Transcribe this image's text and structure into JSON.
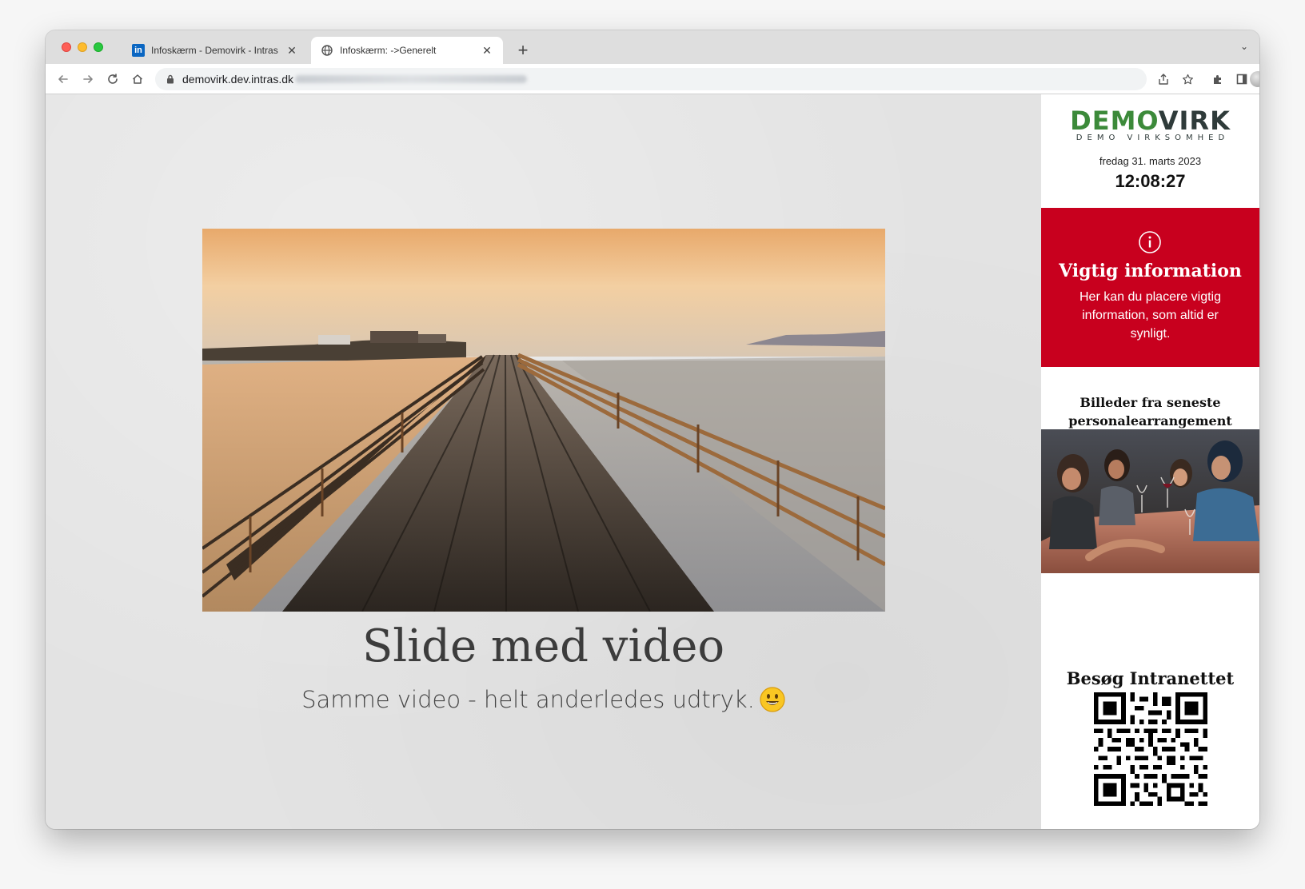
{
  "browser": {
    "tabs": [
      {
        "label": "Infoskærm - Demovirk - Intras",
        "favicon": "linkedin-icon",
        "favicon_text": "in",
        "active": false
      },
      {
        "label": "Infoskærm: ->Generelt",
        "favicon": "globe-icon",
        "active": true
      }
    ],
    "url": "demovirk.dev.intras.dk",
    "colors": {
      "active_tab": "#ffffff",
      "tab_strip": "#dedede"
    }
  },
  "slide": {
    "title": "Slide med video",
    "subtitle": "Samme video - helt anderledes udtryk.",
    "subtitle_emoji": "smiley-icon",
    "image": "boardwalk-pier-sunset-photo"
  },
  "sidebar": {
    "logo": {
      "part1": "DEMO",
      "part2": "VIRK",
      "tagline": "DEMO VIRKSOMHED",
      "colors": {
        "demo": "#3c8a3a",
        "virk": "#2f3b3a"
      }
    },
    "date": "fredag 31. marts 2023",
    "time": "12:08:27",
    "info": {
      "heading": "Vigtig information",
      "text": "Her kan du placere vigtig information, som altid er synligt.",
      "color": "#c8001e",
      "icon": "info-icon"
    },
    "photos": {
      "heading": "Billeder fra seneste personalearrangement",
      "image": "party-dinner-photo"
    },
    "qr": {
      "heading": "Besøg Intranettet",
      "image": "qr-code"
    }
  }
}
